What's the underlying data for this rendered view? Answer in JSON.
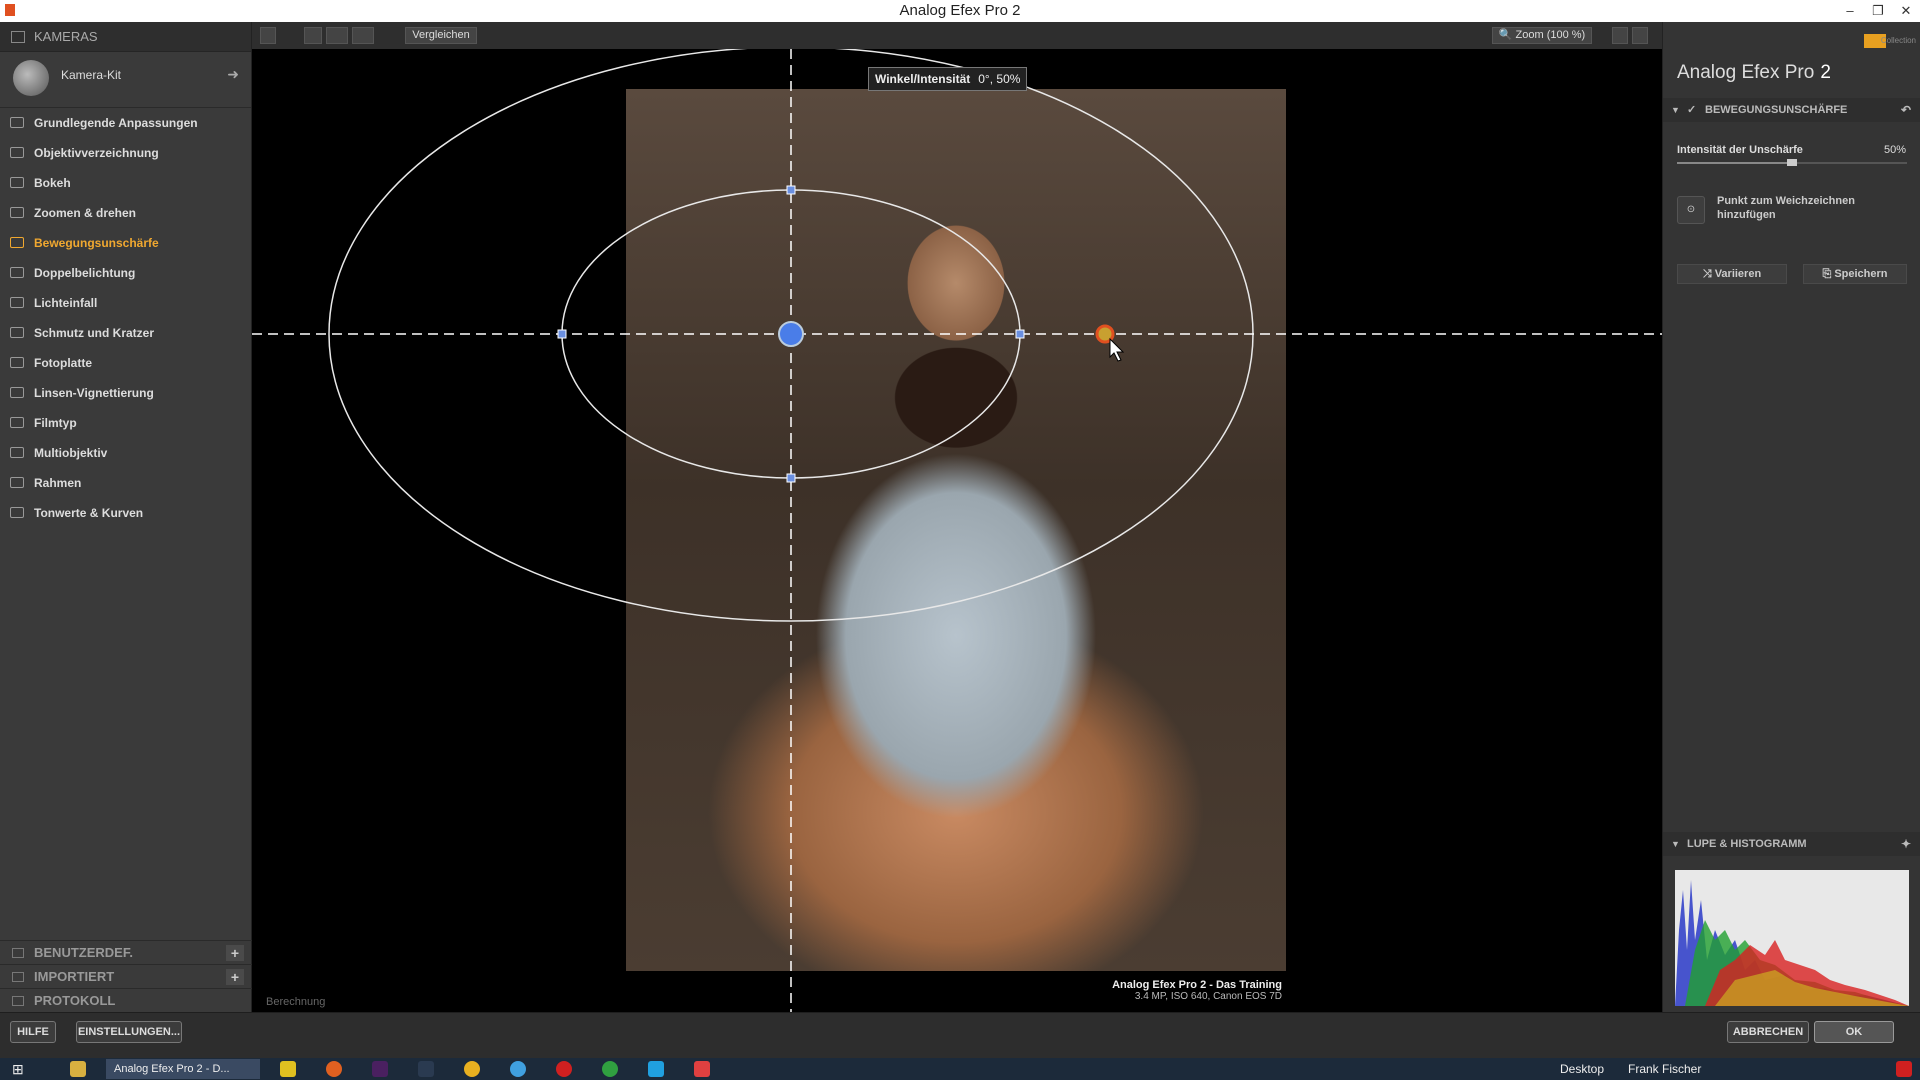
{
  "window": {
    "title": "Analog Efex Pro 2",
    "controls": [
      "–",
      "❐",
      "✕"
    ]
  },
  "left": {
    "header": "KAMERAS",
    "kit_label": "Kamera-Kit",
    "kit_arrow": "➜",
    "items": [
      {
        "label": "Grundlegende Anpassungen",
        "active": false
      },
      {
        "label": "Objektivverzeichnung",
        "active": false
      },
      {
        "label": "Bokeh",
        "active": false
      },
      {
        "label": "Zoomen & drehen",
        "active": false
      },
      {
        "label": "Bewegungsunschärfe",
        "active": true
      },
      {
        "label": "Doppelbelichtung",
        "active": false
      },
      {
        "label": "Lichteinfall",
        "active": false
      },
      {
        "label": "Schmutz und Kratzer",
        "active": false
      },
      {
        "label": "Fotoplatte",
        "active": false
      },
      {
        "label": "Linsen-Vignettierung",
        "active": false
      },
      {
        "label": "Filmtyp",
        "active": false
      },
      {
        "label": "Multiobjektiv",
        "active": false
      },
      {
        "label": "Rahmen",
        "active": false
      },
      {
        "label": "Tonwerte & Kurven",
        "active": false
      }
    ],
    "benutzer": "BENUTZERDEF.",
    "importiert": "IMPORTIERT",
    "protokoll": "PROTOKOLL",
    "plus": "+"
  },
  "toolbar": {
    "compare": "Vergleichen",
    "zoom": "Zoom (100 %)"
  },
  "canvas": {
    "tooltip_label": "Winkel/Intensität",
    "tooltip_value": "0°, 50%",
    "caption_title": "Analog Efex Pro 2 - Das Training",
    "caption_sub": "3.4 MP, ISO 640, Canon EOS 7D",
    "status": "Berechnung"
  },
  "right": {
    "brand": "Analog Efex Pro",
    "brand_num": "2",
    "nik": "Collection",
    "panel_title": "BEWEGUNGSUNSCHÄRFE",
    "slider_label": "Intensität der Unschärfe",
    "slider_value": "50%",
    "slider_level": 0.5,
    "add_point": "Punkt zum Weichzeichnen hinzufügen",
    "variieren": "Variieren",
    "speichern": "Speichern",
    "loupe_title": "LUPE & HISTOGRAMM"
  },
  "bottom": {
    "hilfe": "HILFE",
    "einstellungen": "EINSTELLUNGEN...",
    "abbrechen": "ABBRECHEN",
    "ok": "OK"
  },
  "taskbar": {
    "active_task": "Analog Efex Pro 2 - D...",
    "desktop": "Desktop",
    "user": "Frank Fischer"
  }
}
